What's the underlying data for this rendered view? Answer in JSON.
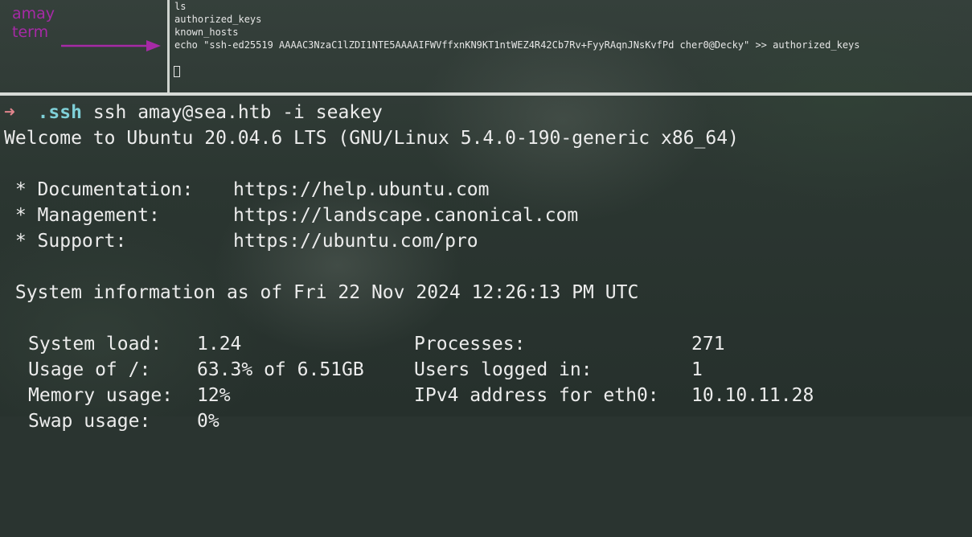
{
  "annotation": {
    "label_line1": "amay",
    "label_line2": "term",
    "color": "#a62aa6"
  },
  "top_pane": {
    "lines": [
      "ls",
      "authorized_keys",
      "known_hosts",
      "echo \"ssh-ed25519 AAAAC3NzaC1lZDI1NTE5AAAAIFWVffxnKN9KT1ntWEZ4R42Cb7Rv+FyyRAqnJNsKvfPd cher0@Decky\" >> authorized_keys"
    ]
  },
  "main_pane": {
    "prompt": {
      "arrow": "➜",
      "dir": ".ssh",
      "command": "ssh amay@sea.htb -i seakey"
    },
    "welcome": "Welcome to Ubuntu 20.04.6 LTS (GNU/Linux 5.4.0-190-generic x86_64)",
    "links": [
      {
        "label": " * Documentation:",
        "url": "https://help.ubuntu.com"
      },
      {
        "label": " * Management:",
        "url": "https://landscape.canonical.com"
      },
      {
        "label": " * Support:",
        "url": "https://ubuntu.com/pro"
      }
    ],
    "sysinfo_header": " System information as of Fri 22 Nov 2024 12:26:13 PM UTC",
    "stats": [
      {
        "k1": "System load:",
        "v1": "1.24",
        "k2": "Processes:",
        "v2": "271"
      },
      {
        "k1": "Usage of /:",
        "v1": "63.3% of 6.51GB",
        "k2": "Users logged in:",
        "v2": "1"
      },
      {
        "k1": "Memory usage:",
        "v1": "12%",
        "k2": "IPv4 address for eth0:",
        "v2": "10.10.11.28"
      },
      {
        "k1": "Swap usage:",
        "v1": "0%",
        "k2": "",
        "v2": ""
      }
    ]
  }
}
